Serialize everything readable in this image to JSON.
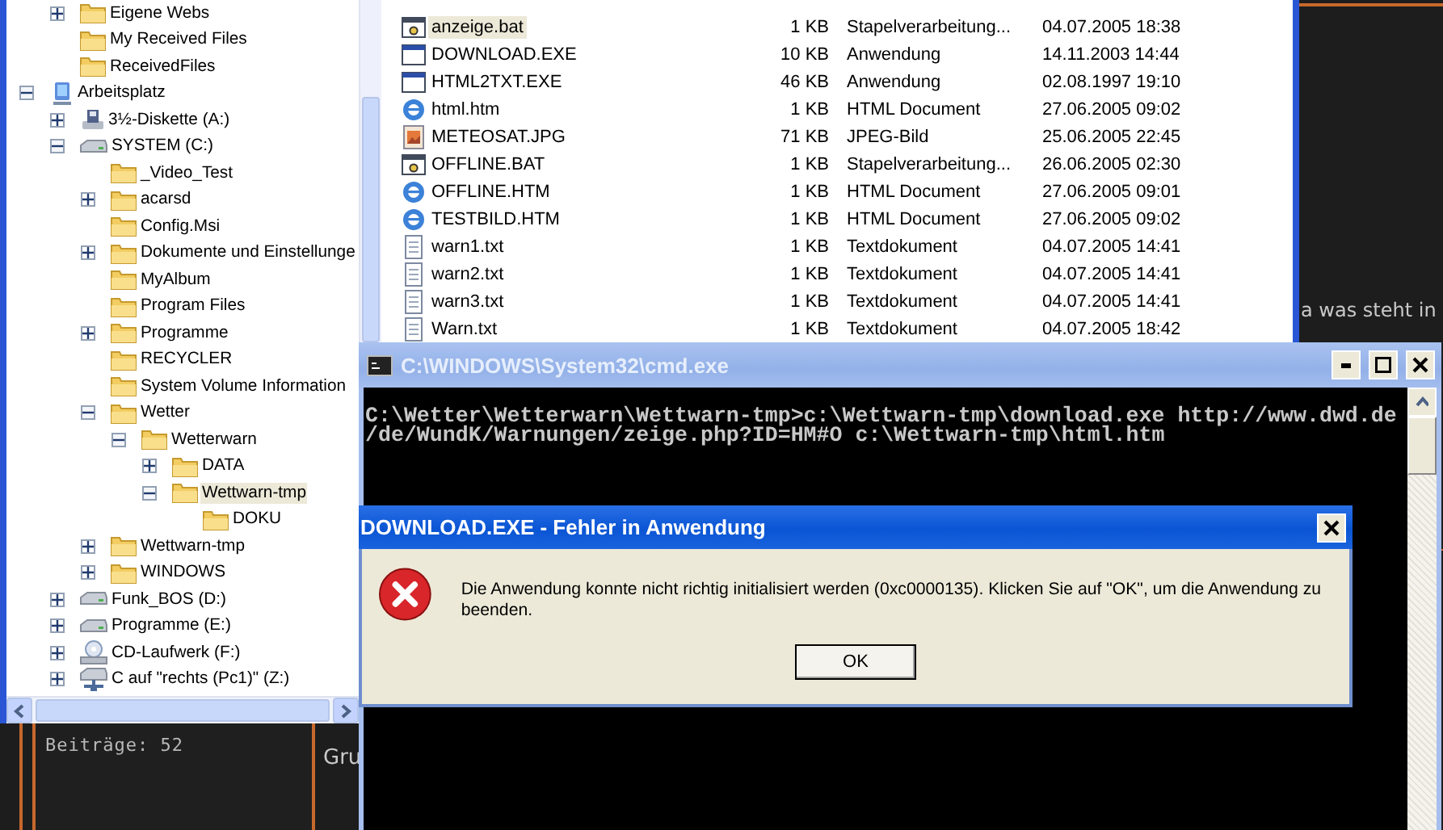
{
  "explorer": {
    "tree": {
      "continued_items": [
        {
          "label": "Eigene Webs",
          "kind": "folder",
          "has_children": true,
          "expanded": false,
          "selected": false
        },
        {
          "label": "My Received Files",
          "kind": "folder",
          "selected": false
        },
        {
          "label": "ReceivedFiles",
          "kind": "folder",
          "selected": false
        }
      ],
      "items": [
        {
          "label": "Arbeitsplatz",
          "kind": "computer",
          "has_children": true,
          "expanded": true,
          "selected": false,
          "children": [
            {
              "label": "3½-Diskette (A:)",
              "kind": "floppy",
              "has_children": true,
              "expanded": false,
              "selected": false
            },
            {
              "label": "SYSTEM (C:)",
              "kind": "drive",
              "has_children": true,
              "expanded": true,
              "selected": false,
              "children": [
                {
                  "label": "_Video_Test",
                  "kind": "folder",
                  "selected": false
                },
                {
                  "label": "acarsd",
                  "kind": "folder",
                  "has_children": true,
                  "expanded": false,
                  "selected": false
                },
                {
                  "label": "Config.Msi",
                  "kind": "folder",
                  "selected": false
                },
                {
                  "label": "Dokumente und Einstellunge",
                  "kind": "folder",
                  "has_children": true,
                  "expanded": false,
                  "selected": false
                },
                {
                  "label": "MyAlbum",
                  "kind": "folder",
                  "selected": false
                },
                {
                  "label": "Program Files",
                  "kind": "folder",
                  "selected": false
                },
                {
                  "label": "Programme",
                  "kind": "folder",
                  "has_children": true,
                  "expanded": false,
                  "selected": false
                },
                {
                  "label": "RECYCLER",
                  "kind": "folder",
                  "selected": false
                },
                {
                  "label": "System Volume Information",
                  "kind": "folder",
                  "selected": false
                },
                {
                  "label": "Wetter",
                  "kind": "folder",
                  "has_children": true,
                  "expanded": true,
                  "selected": false,
                  "children": [
                    {
                      "label": "Wetterwarn",
                      "kind": "folder",
                      "has_children": true,
                      "expanded": true,
                      "selected": false,
                      "children": [
                        {
                          "label": "DATA",
                          "kind": "folder",
                          "has_children": true,
                          "expanded": false,
                          "selected": false
                        },
                        {
                          "label": "Wettwarn-tmp",
                          "kind": "folder",
                          "has_children": true,
                          "expanded": true,
                          "selected": true,
                          "children": [
                            {
                              "label": "DOKU",
                              "kind": "folder",
                              "selected": false
                            }
                          ]
                        }
                      ]
                    }
                  ]
                },
                {
                  "label": "Wettwarn-tmp",
                  "kind": "folder",
                  "has_children": true,
                  "expanded": false,
                  "selected": false
                },
                {
                  "label": "WINDOWS",
                  "kind": "folder",
                  "has_children": true,
                  "expanded": false,
                  "selected": false
                }
              ]
            },
            {
              "label": "Funk_BOS (D:)",
              "kind": "drive",
              "has_children": true,
              "expanded": false,
              "selected": false
            },
            {
              "label": "Programme (E:)",
              "kind": "drive",
              "has_children": true,
              "expanded": false,
              "selected": false
            },
            {
              "label": "CD-Laufwerk (F:)",
              "kind": "cdrom",
              "has_children": true,
              "expanded": false,
              "selected": false
            },
            {
              "label": "C auf \"rechts (Pc1)\" (Z:)",
              "kind": "network",
              "has_children": true,
              "expanded": false,
              "selected": false
            }
          ]
        }
      ]
    },
    "files": [
      {
        "name": "anzeige.bat",
        "kind": "bat",
        "size": "1 KB",
        "type": "Stapelverarbeitung...",
        "modified": "04.07.2005 18:38",
        "selected": true
      },
      {
        "name": "DOWNLOAD.EXE",
        "kind": "exe",
        "size": "10 KB",
        "type": "Anwendung",
        "modified": "14.11.2003 14:44",
        "selected": false
      },
      {
        "name": "HTML2TXT.EXE",
        "kind": "exe",
        "size": "46 KB",
        "type": "Anwendung",
        "modified": "02.08.1997 19:10",
        "selected": false
      },
      {
        "name": "html.htm",
        "kind": "htm",
        "size": "1 KB",
        "type": "HTML Document",
        "modified": "27.06.2005 09:02",
        "selected": false
      },
      {
        "name": "METEOSAT.JPG",
        "kind": "jpg",
        "size": "71 KB",
        "type": "JPEG-Bild",
        "modified": "25.06.2005 22:45",
        "selected": false
      },
      {
        "name": "OFFLINE.BAT",
        "kind": "bat",
        "size": "1 KB",
        "type": "Stapelverarbeitung...",
        "modified": "26.06.2005 02:30",
        "selected": false
      },
      {
        "name": "OFFLINE.HTM",
        "kind": "htm",
        "size": "1 KB",
        "type": "HTML Document",
        "modified": "27.06.2005 09:01",
        "selected": false
      },
      {
        "name": "TESTBILD.HTM",
        "kind": "htm",
        "size": "1 KB",
        "type": "HTML Document",
        "modified": "27.06.2005 09:02",
        "selected": false
      },
      {
        "name": "warn1.txt",
        "kind": "txt",
        "size": "1 KB",
        "type": "Textdokument",
        "modified": "04.07.2005 14:41",
        "selected": false
      },
      {
        "name": "warn2.txt",
        "kind": "txt",
        "size": "1 KB",
        "type": "Textdokument",
        "modified": "04.07.2005 14:41",
        "selected": false
      },
      {
        "name": "warn3.txt",
        "kind": "txt",
        "size": "1 KB",
        "type": "Textdokument",
        "modified": "04.07.2005 14:41",
        "selected": false
      },
      {
        "name": "Warn.txt",
        "kind": "txt",
        "size": "1 KB",
        "type": "Textdokument",
        "modified": "04.07.2005 18:42",
        "selected": false
      }
    ]
  },
  "console": {
    "title": "C:\\WINDOWS\\System32\\cmd.exe",
    "lines": [
      "C:\\Wetter\\Wetterwarn\\Wettwarn-tmp>c:\\Wettwarn-tmp\\download.exe http://www.dwd.de",
      "/de/WundK/Warnungen/zeige.php?ID=HM#O c:\\Wettwarn-tmp\\html.htm"
    ]
  },
  "dialog": {
    "title": "DOWNLOAD.EXE - Fehler in Anwendung",
    "message": "Die Anwendung konnte nicht richtig initialisiert werden (0xc0000135). Klicken Sie auf \"OK\", um die Anwendung zu beenden.",
    "buttons": [
      "OK"
    ]
  },
  "background_page": {
    "post_count": "Beiträge: 52",
    "text_1": "Gru",
    "text_2": "a was steht in"
  }
}
